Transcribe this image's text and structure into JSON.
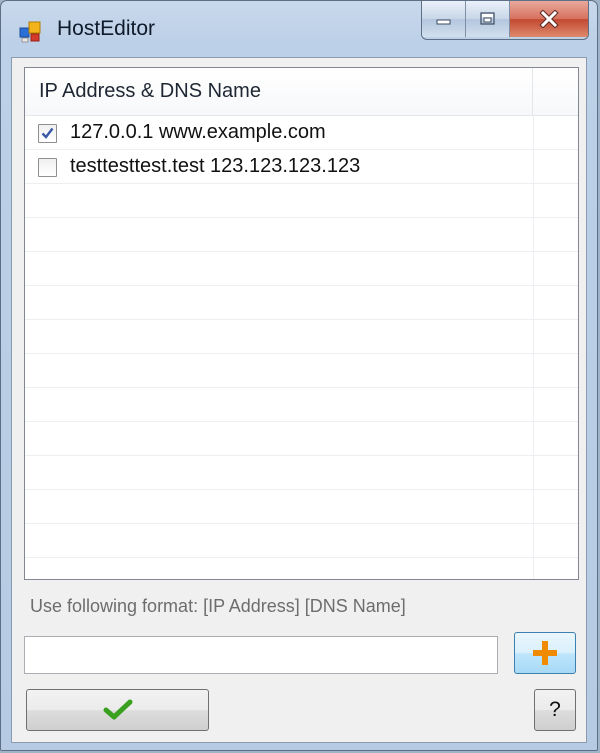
{
  "window": {
    "title": "HostEditor"
  },
  "listview": {
    "column_header": "IP Address & DNS Name",
    "rows": [
      {
        "text": "127.0.0.1 www.example.com",
        "checked": true
      },
      {
        "text": "testtesttest.test 123.123.123.123",
        "checked": false
      }
    ]
  },
  "form": {
    "format_hint": "Use following format:  [IP Address] [DNS Name]",
    "entry_value": "",
    "add_icon": "plus-icon",
    "ok_icon": "checkmark-icon",
    "help_label": "?"
  },
  "colors": {
    "plus": "#f08a00",
    "check": "#3aa020"
  }
}
